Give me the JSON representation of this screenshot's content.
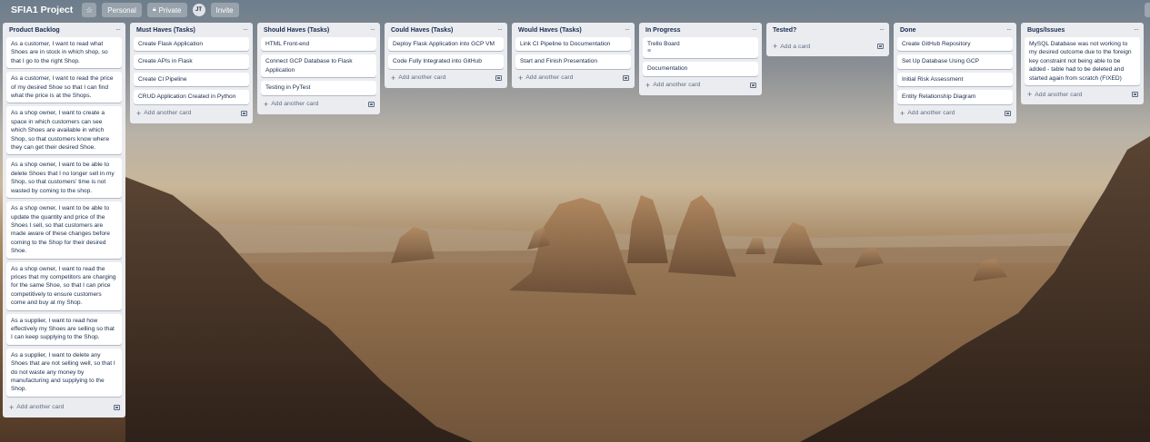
{
  "board": {
    "title": "SFIA1 Project",
    "visibility": "Personal",
    "privacy": "Private",
    "member_initials": "JT",
    "invite_label": "Invite",
    "star_icon": "star-icon",
    "lock_icon": "lock-icon"
  },
  "add_card_label": "Add another card",
  "lists": [
    {
      "title": "Product Backlog",
      "cards": [
        "As a customer, I want to read what Shoes are in stock in which shop, so that I go to the right Shop.",
        "As a customer, I want to read the price of my desired Shoe so that I can find what the price is at the Shops.",
        "As a shop owner, I want to create a space in which customers can see which Shoes are available in which Shop, so that customers know where they can get their desired Shoe.",
        "As a shop owner, I want to be able to delete Shoes that I no longer sell in my Shop, so that customers' time is not wasted by coming to the shop.",
        "As a shop owner, I want to be able to update the quantity and price of the Shoes I sell, so that customers are made aware of these changes before coming to the Shop for their desired Shoe.",
        "As a shop owner, I want to read the prices that my competitors are charging for the same Shoe, so that I can price competitively to ensure customers come and buy at my Shop.",
        "As a supplier, I want to read how effectively my Shoes are selling so that I can keep supplying to the Shop.",
        "As a supplier, I want to delete any Shoes that are not selling well, so that I do not waste any money by manufacturing and supplying to the Shop."
      ]
    },
    {
      "title": "Must Haves (Tasks)",
      "cards": [
        "Create Flask Application",
        "Create APIs in Flask",
        "Create CI Pipeline",
        "CRUD Application Created in Python"
      ]
    },
    {
      "title": "Should Haves (Tasks)",
      "cards": [
        "HTML Front-end",
        "Connect GCP Database to Flask Application",
        "Testing in PyTest"
      ]
    },
    {
      "title": "Could Haves (Tasks)",
      "cards": [
        "Deploy Flask Application into GCP VM",
        "Code Fully Integrated into GitHub"
      ]
    },
    {
      "title": "Would Haves (Tasks)",
      "cards": [
        "Link CI Pipeline to Documentation",
        "Start and Finish Presentation"
      ]
    },
    {
      "title": "In Progress",
      "cards": [
        "Trello Board",
        "Documentation"
      ]
    },
    {
      "title": "Tested?",
      "cards": [],
      "add_label": "Add a card"
    },
    {
      "title": "Done",
      "cards": [
        "Create GitHub Repository",
        "Set Up Database Using GCP",
        "Initial Risk Assessment",
        "Entity Relationship Diagram"
      ]
    },
    {
      "title": "Bugs/Issues",
      "cards": [
        "MySQL Database was not working to my desired outcome due to the foreign key constraint not being able to be added - table had to be deleted and started again from scratch (FIXED)"
      ]
    }
  ]
}
